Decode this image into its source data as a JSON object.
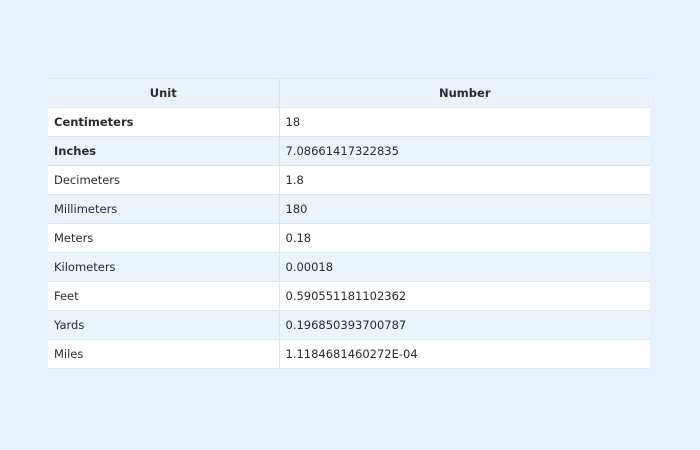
{
  "table": {
    "headers": [
      "Unit",
      "Number"
    ],
    "rows": [
      {
        "unit": "Centimeters",
        "number": "18",
        "bold": true
      },
      {
        "unit": "Inches",
        "number": "7.08661417322835",
        "bold": true
      },
      {
        "unit": "Decimeters",
        "number": "1.8",
        "bold": false
      },
      {
        "unit": "Millimeters",
        "number": "180",
        "bold": false
      },
      {
        "unit": "Meters",
        "number": "0.18",
        "bold": false
      },
      {
        "unit": "Kilometers",
        "number": "0.00018",
        "bold": false
      },
      {
        "unit": "Feet",
        "number": "0.590551181102362",
        "bold": false
      },
      {
        "unit": "Yards",
        "number": "0.196850393700787",
        "bold": false
      },
      {
        "unit": "Miles",
        "number": "1.1184681460272E-04",
        "bold": false
      }
    ]
  },
  "colors": {
    "page_background": "#e8f1fb",
    "header_background": "#e9f2fb",
    "row_alt_background": "#ebf3fb",
    "row_background": "#ffffff",
    "border": "#dde5ee"
  }
}
